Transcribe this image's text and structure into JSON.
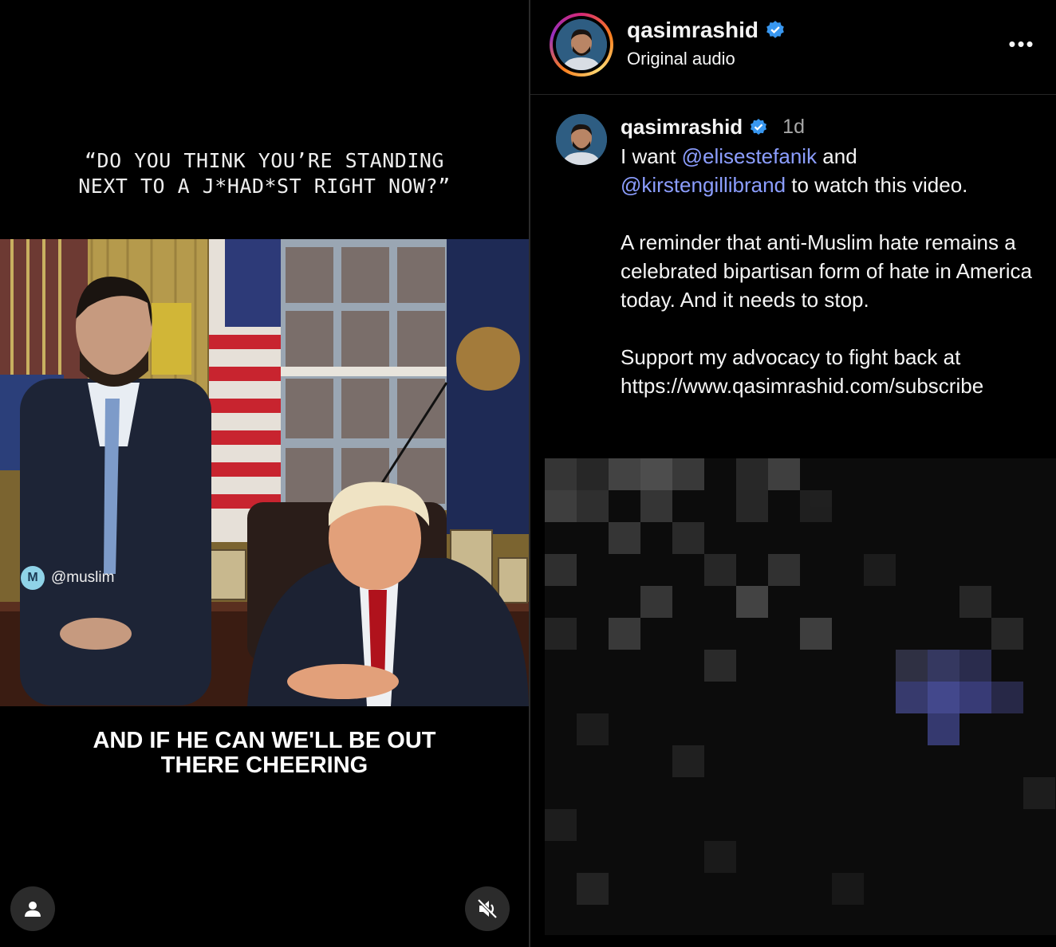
{
  "video": {
    "caption_top": "“DO YOU THINK YOU’RE STANDING\nNEXT TO A J*HAD*ST RIGHT NOW?”",
    "caption_bottom": "AND IF HE CAN WE'LL BE OUT\nTHERE CHEERING",
    "watermark": "@muslim",
    "watermark_badge": "M",
    "profile_icon": "person-icon",
    "mute_icon": "speaker-muted-icon"
  },
  "header": {
    "username": "qasimrashid",
    "subtitle": "Original audio",
    "more_icon": "more-horizontal-icon",
    "more_label": "•••"
  },
  "comment": {
    "username": "qasimrashid",
    "time": "1d",
    "line1_prefix": "I want ",
    "mention1": "@elisestefanik",
    "line1_suffix": " and",
    "mention2": "@kirstengillibrand",
    "line2_suffix": " to watch this video.",
    "paragraph2": "A reminder that anti-Muslim hate remains a celebrated bipartisan form of hate in America today. And it needs to stop.",
    "paragraph3_line1": "Support my advocacy to fight back at",
    "paragraph3_link": "https://www.qasimrashid.com/subscribe"
  },
  "colors": {
    "background": "#000000",
    "mention": "#8c9eff",
    "verified": "#3897f0",
    "time": "#a8a8a8"
  }
}
